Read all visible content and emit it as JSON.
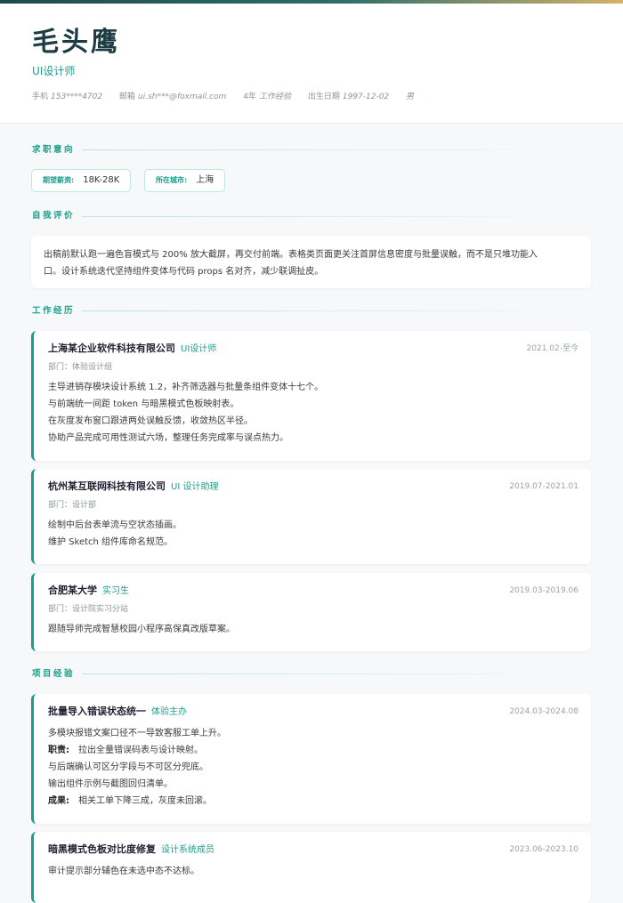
{
  "header": {
    "name": "毛头鹰",
    "title": "UI设计师",
    "phone_label": "手机",
    "phone": "153****4702",
    "email_label": "邮箱",
    "email": "ui.sh***@foxmail.com",
    "experience_label": "4年",
    "experience": "工作经验",
    "birth_label": "出生日期",
    "birth": "1997-12-02",
    "gender": "男"
  },
  "sections": {
    "intent": "求职意向",
    "summary": "自我评价",
    "work": "工作经历",
    "projects": "项目经验"
  },
  "intent": {
    "salary_label": "期望薪资:",
    "salary": "18K-28K",
    "city_label": "所在城市:",
    "city": "上海"
  },
  "summary": {
    "line1": "出稿前默认跑一遍色盲模式与 200% 放大截屏，再交付前端。表格类页面更关注首屏信息密度与批量误触，而不是只堆功能入",
    "line2": "口。设计系统迭代坚持组件变体与代码 props 名对齐，减少联调扯皮。"
  },
  "work": [
    {
      "company": "上海某企业软件科技有限公司",
      "role": "UI设计师",
      "date": "2021.02-至今",
      "dept": "部门：体验设计组",
      "lines": [
        "主导进销存模块设计系统 1.2，补齐筛选器与批量条组件变体十七个。",
        "与前端统一间距 token 与暗黑模式色板映射表。",
        "在灰度发布窗口跟进两处误触反馈，收敛热区半径。",
        "协助产品完成可用性测试六场，整理任务完成率与误点热力。"
      ]
    },
    {
      "company": "杭州某互联网科技有限公司",
      "role": "UI 设计助理",
      "date": "2019.07-2021.01",
      "dept": "部门：设计部",
      "lines": [
        "绘制中后台表单流与空状态插画。",
        "维护 Sketch 组件库命名规范。"
      ]
    },
    {
      "company": "合肥某大学",
      "role": "实习生",
      "date": "2019.03-2019.06",
      "dept": "部门：设计院实习分站",
      "lines": [
        "跟随导师完成智慧校园小程序高保真改版草案。"
      ]
    }
  ],
  "projects": [
    {
      "name": "批量导入错误状态统一",
      "role": "体验主办",
      "date": "2024.03-2024.08",
      "line1": "多模块报错文案口径不一导致客服工单上升。",
      "duty_label": "职责:",
      "duty1": "拉出全量错误码表与设计映射。",
      "line3": "与后端确认可区分字段与不可区分兜底。",
      "line4": "输出组件示例与截图回归清单。",
      "result_label": "成果:",
      "result": "相关工单下降三成，灰度未回滚。"
    },
    {
      "name": "暗黑模式色板对比度修复",
      "role": "设计系统成员",
      "date": "2023.06-2023.10",
      "line1": "审计提示部分辅色在未选中态不达标。"
    }
  ]
}
